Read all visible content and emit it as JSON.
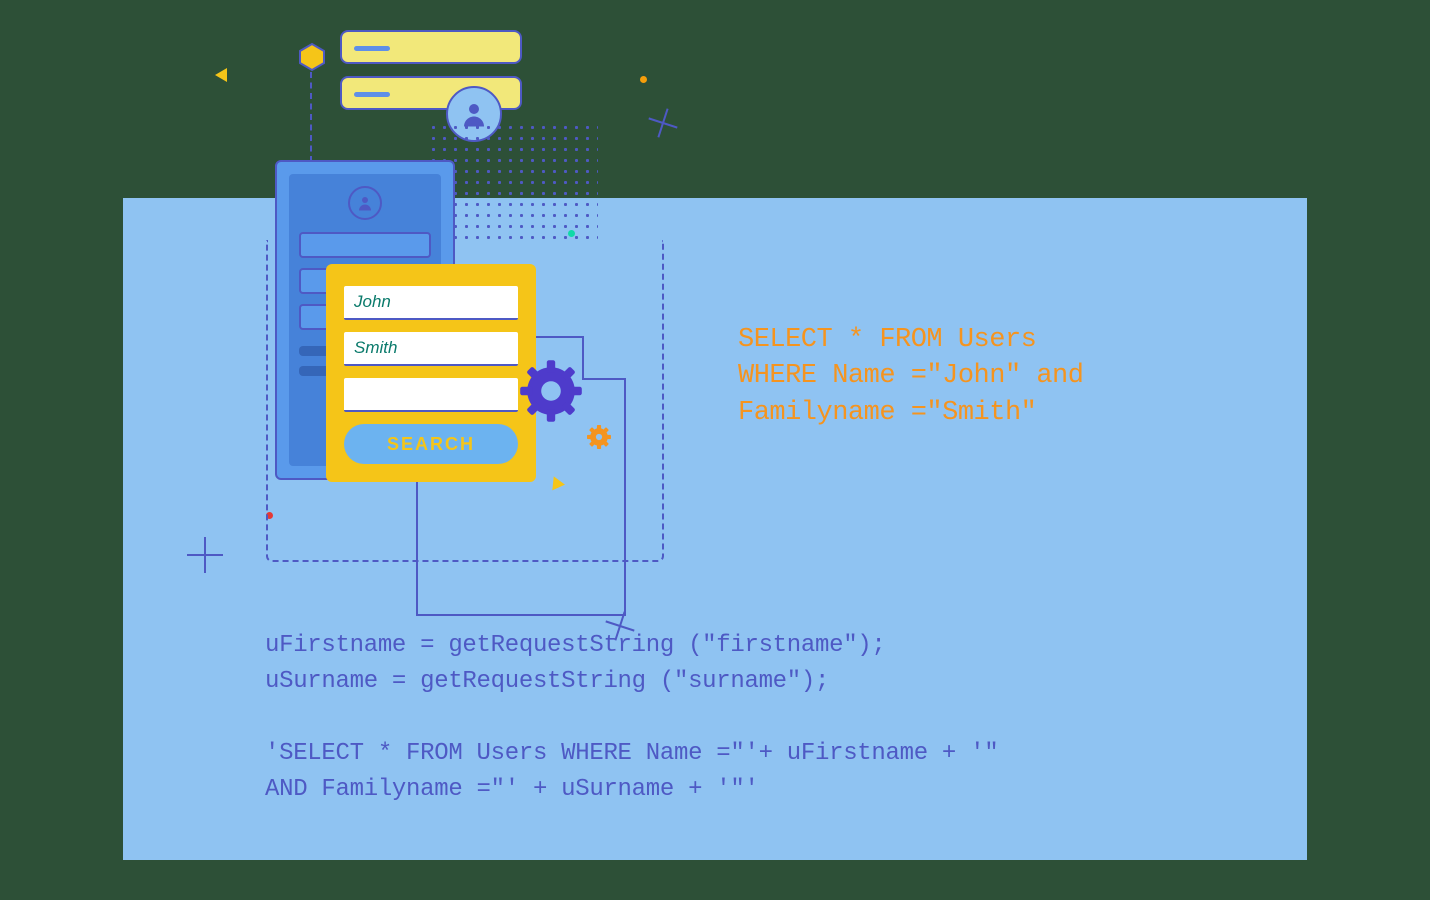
{
  "form": {
    "first_name_value": "John",
    "last_name_value": "Smith",
    "search_label": "SEARCH"
  },
  "sql_display": {
    "line1": "SELECT * FROM Users",
    "line2": "WHERE  Name =\"John\" and",
    "line3": "Familyname =\"Smith\""
  },
  "code": {
    "line1": "uFirstname = getRequestString (\"firstname\");",
    "line2": "uSurname = getRequestString (\"surname\");",
    "line3": "",
    "line4": "'SELECT * FROM Users WHERE Name =\"'+ uFirstname + '\"",
    "line5": "AND Familyname =\"' + uSurname + '\"'"
  }
}
